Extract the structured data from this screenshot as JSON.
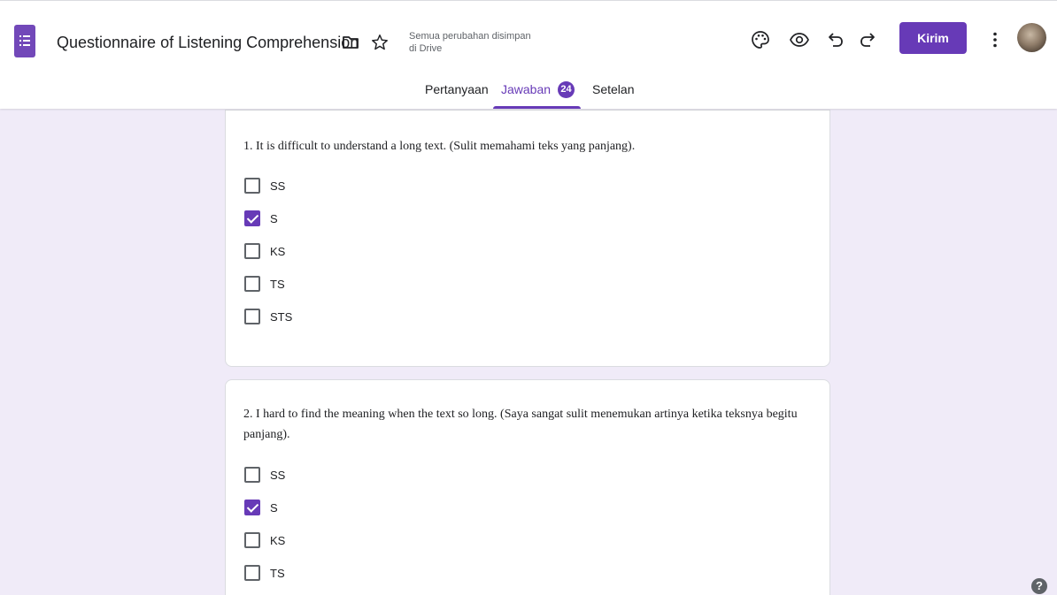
{
  "header": {
    "title": "Questionnaire of Listening Comprehension",
    "save_status_line1": "Semua perubahan disimpan",
    "save_status_line2": "di Drive",
    "send_label": "Kirim",
    "icons": [
      "forms-logo-icon",
      "folder-icon",
      "star-icon",
      "palette-icon",
      "preview-eye-icon",
      "undo-icon",
      "redo-icon",
      "more-vert-icon",
      "avatar"
    ]
  },
  "tabs": [
    {
      "label": "Pertanyaan",
      "active": false
    },
    {
      "label": "Jawaban",
      "active": true,
      "badge": "24"
    },
    {
      "label": "Setelan",
      "active": false
    }
  ],
  "questions": [
    {
      "text": "1. It is difficult to understand a long text. (Sulit memahami teks yang panjang).",
      "options": [
        {
          "label": "SS",
          "checked": false
        },
        {
          "label": "S",
          "checked": true
        },
        {
          "label": "KS",
          "checked": false
        },
        {
          "label": "TS",
          "checked": false
        },
        {
          "label": "STS",
          "checked": false
        }
      ]
    },
    {
      "text": "2. I hard to find the meaning when the text so long. (Saya sangat sulit menemukan artinya ketika teksnya begitu panjang).",
      "options": [
        {
          "label": "SS",
          "checked": false
        },
        {
          "label": "S",
          "checked": true
        },
        {
          "label": "KS",
          "checked": false
        },
        {
          "label": "TS",
          "checked": false
        }
      ]
    }
  ],
  "help_label": "?",
  "colors": {
    "accent": "#673ab7",
    "background": "#f0ebf8"
  }
}
